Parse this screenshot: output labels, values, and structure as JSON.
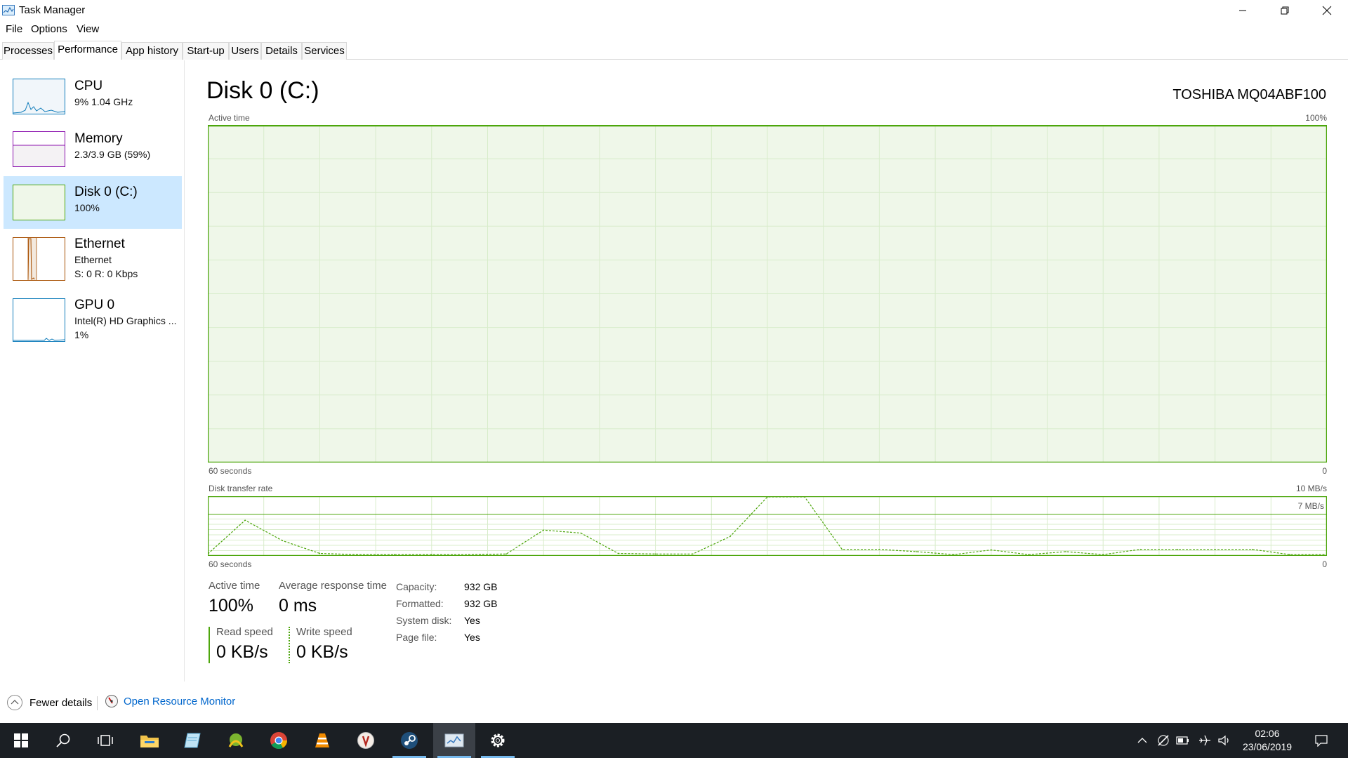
{
  "window": {
    "title": "Task Manager",
    "controls": [
      "minimize",
      "restore",
      "close"
    ]
  },
  "menu": [
    "File",
    "Options",
    "View"
  ],
  "tabs": [
    {
      "label": "Processes",
      "active": false
    },
    {
      "label": "Performance",
      "active": true
    },
    {
      "label": "App history",
      "active": false
    },
    {
      "label": "Start-up",
      "active": false
    },
    {
      "label": "Users",
      "active": false
    },
    {
      "label": "Details",
      "active": false
    },
    {
      "label": "Services",
      "active": false
    }
  ],
  "sidebar": [
    {
      "name": "CPU",
      "sub1": "9%  1.04 GHz",
      "sub2": "",
      "color": "#117dbb",
      "selected": false
    },
    {
      "name": "Memory",
      "sub1": "2.3/3.9 GB (59%)",
      "sub2": "",
      "color": "#8b12ae",
      "selected": false
    },
    {
      "name": "Disk 0 (C:)",
      "sub1": "100%",
      "sub2": "",
      "color": "#4da60c",
      "selected": true
    },
    {
      "name": "Ethernet",
      "sub1": "Ethernet",
      "sub2": "S: 0  R: 0 Kbps",
      "color": "#a74f01",
      "selected": false
    },
    {
      "name": "GPU 0",
      "sub1": "Intel(R) HD Graphics ...",
      "sub2": "1%",
      "color": "#117dbb",
      "selected": false
    }
  ],
  "main": {
    "title": "Disk 0 (C:)",
    "device_model": "TOSHIBA MQ04ABF100",
    "active_graph": {
      "label": "Active time",
      "max_label": "100%",
      "time_label": "60 seconds",
      "min_label": "0"
    },
    "rate_graph": {
      "label": "Disk transfer rate",
      "max_label": "10 MB/s",
      "mid_label": "7 MB/s",
      "time_label": "60 seconds",
      "min_label": "0"
    },
    "stats": {
      "active_time_label": "Active time",
      "active_time_value": "100%",
      "response_label": "Average response time",
      "response_value": "0 ms",
      "read_label": "Read speed",
      "read_value": "0 KB/s",
      "write_label": "Write speed",
      "write_value": "0 KB/s"
    },
    "info": [
      {
        "label": "Capacity:",
        "value": "932 GB"
      },
      {
        "label": "Formatted:",
        "value": "932 GB"
      },
      {
        "label": "System disk:",
        "value": "Yes"
      },
      {
        "label": "Page file:",
        "value": "Yes"
      }
    ]
  },
  "footer": {
    "fewer_details": "Fewer details",
    "resource_monitor": "Open Resource Monitor"
  },
  "taskbar": {
    "apps": [
      "start",
      "search",
      "task-view",
      "file-explorer",
      "notepad",
      "tree-app",
      "chrome",
      "vlc",
      "browser-app",
      "steam",
      "task-manager",
      "settings"
    ],
    "clock_time": "02:06",
    "clock_date": "23/06/2019"
  },
  "colors": {
    "disk_line": "#4da60c",
    "disk_fill": "#eff7e9",
    "disk_grid": "#d8eccb",
    "selection": "#cce8ff",
    "link": "#0066cc"
  },
  "chart_data": {
    "type": "line",
    "title": "Disk transfer rate",
    "xlabel": "60 seconds",
    "ylim": [
      0,
      10
    ],
    "y_unit": "MB/s",
    "x": [
      60,
      58,
      56,
      54,
      52,
      50,
      48,
      46,
      44,
      42,
      40,
      38,
      36,
      34,
      32,
      30,
      28,
      26,
      24,
      22,
      20,
      18,
      16,
      14,
      12,
      10,
      8,
      6,
      4,
      2,
      0
    ],
    "series": [
      {
        "values": [
          0.2,
          6.0,
          2.5,
          0.3,
          0.1,
          0.1,
          0.1,
          0.1,
          0.2,
          4.3,
          3.8,
          0.3,
          0.2,
          0.2,
          3.2,
          10.0,
          10.0,
          1.0,
          1.0,
          0.6,
          0.1,
          0.9,
          0.1,
          0.6,
          0.1,
          1.0,
          1.0,
          1.0,
          1.0,
          0.1,
          0.1
        ]
      }
    ]
  }
}
